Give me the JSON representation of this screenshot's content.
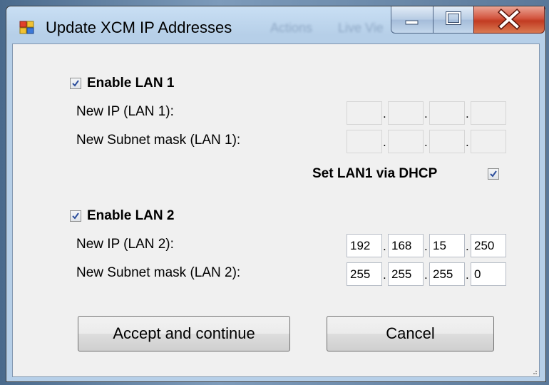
{
  "window": {
    "title": "Update XCM IP Addresses",
    "obscured_background_text": [
      "Actions",
      "Live Vie"
    ]
  },
  "lan1": {
    "enable_label": "Enable LAN 1",
    "enabled": true,
    "ip_label": "New IP (LAN 1):",
    "ip_octets": [
      "",
      "",
      "",
      ""
    ],
    "subnet_label": "New Subnet mask (LAN 1):",
    "subnet_octets": [
      "",
      "",
      "",
      ""
    ],
    "dhcp_label": "Set LAN1 via DHCP",
    "dhcp_checked": true
  },
  "lan2": {
    "enable_label": "Enable LAN 2",
    "enabled": true,
    "ip_label": "New IP (LAN 2):",
    "ip_octets": [
      "192",
      "168",
      "15",
      "250"
    ],
    "subnet_label": "New Subnet mask (LAN 2):",
    "subnet_octets": [
      "255",
      "255",
      "255",
      "0"
    ]
  },
  "buttons": {
    "accept_label": "Accept and continue",
    "cancel_label": "Cancel"
  },
  "icons": {
    "app": "app-window-icon",
    "minimize": "minimize-icon",
    "maximize": "maximize-icon",
    "close": "close-icon",
    "check": "checkmark-icon",
    "resize": "resize-grip-icon"
  },
  "colors": {
    "close_button": "#c23b22",
    "client_background": "#f0f0f0",
    "checkmark": "#2b4d9c"
  }
}
